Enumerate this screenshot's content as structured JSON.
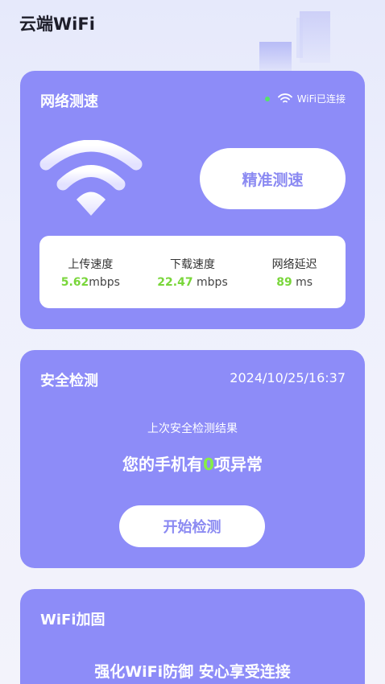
{
  "app": {
    "title": "云端WiFi"
  },
  "speed_card": {
    "title": "网络测速",
    "status_text": "WiFi已连接",
    "precise_button": "精准测速",
    "upload": {
      "label": "上传速度",
      "value": "5.62",
      "unit": "mbps"
    },
    "download": {
      "label": "下载速度",
      "value": "22.47",
      "unit": " mbps"
    },
    "latency": {
      "label": "网络延迟",
      "value": "89",
      "unit": " ms"
    }
  },
  "security_card": {
    "title": "安全检测",
    "date": "2024/10/25/16:37",
    "caption": "上次安全检测结果",
    "result_prefix": "您的手机有",
    "result_count": "0",
    "result_suffix": "项异常",
    "start_button": "开始检测"
  },
  "wifi_card": {
    "title": "WiFi加固",
    "slogan": "强化WiFi防御 安心享受连接"
  },
  "colors": {
    "card": "#8d8cf8",
    "accent_green": "#79d63a",
    "button_text": "#8b8af2"
  },
  "icons": [
    "wifi-icon",
    "wifi-status-icon"
  ]
}
